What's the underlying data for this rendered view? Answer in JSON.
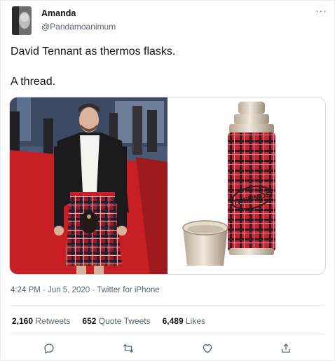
{
  "author": {
    "name": "Amanda",
    "handle": "@Pandamoanimum"
  },
  "more_icon_label": "···",
  "tweet": {
    "line1": "David Tennant as thermos flasks.",
    "line2": "A thread."
  },
  "media": {
    "left_image": "man in tartan kilt on red carpet",
    "right_image": "tartan thermos flask with cup",
    "thermos_logo_text": "THERMOS"
  },
  "meta": {
    "time": "4:24 PM",
    "sep1": " · ",
    "date": "Jun 5, 2020",
    "sep2": " · ",
    "source": "Twitter for iPhone"
  },
  "stats": {
    "retweets_count": "2,160",
    "retweets_label": "Retweets",
    "quotes_count": "652",
    "quotes_label": "Quote Tweets",
    "likes_count": "6,489",
    "likes_label": "Likes"
  },
  "actions": [
    "reply-icon",
    "retweet-icon",
    "like-icon",
    "share-icon"
  ],
  "colors": {
    "text": "#0f1419",
    "secondary": "#536471",
    "divider": "#e6ecf0",
    "carpet": "#c81f25",
    "tartan_red": "#c4232f"
  }
}
